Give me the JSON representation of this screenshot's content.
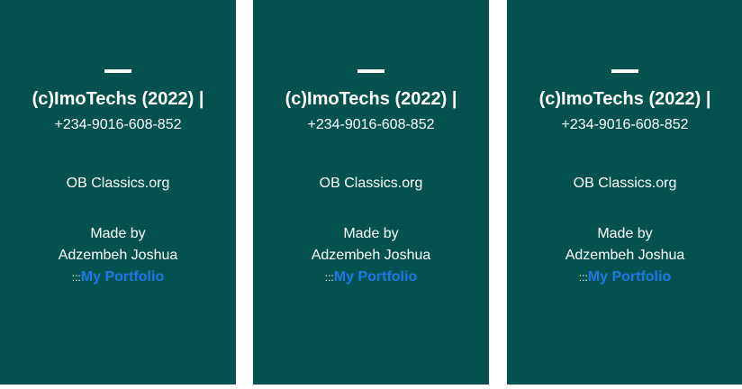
{
  "footer": {
    "copyright": "(c)ImoTechs (2022) |",
    "phone": "+234-9016-608-852",
    "site": "OB Classics.org",
    "made_by": "Made by",
    "author": "Adzembeh Joshua",
    "separator": ":::",
    "portfolio_link": "My Portfolio"
  },
  "colors": {
    "panel_background": "#03524f",
    "text": "#ffffff",
    "link": "#1e78e6"
  }
}
